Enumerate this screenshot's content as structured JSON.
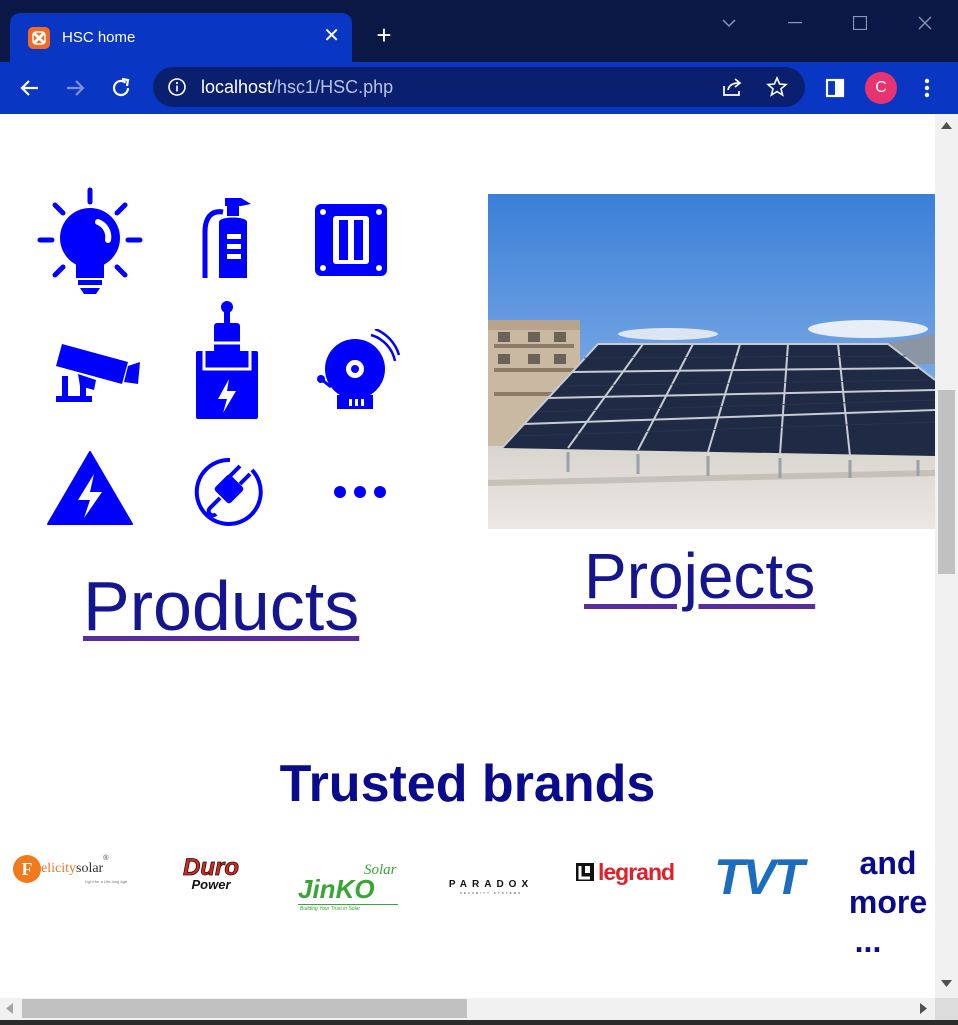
{
  "browser": {
    "tab_title": "HSC home",
    "url_host": "localhost",
    "url_path": "/hsc1/HSC.php",
    "profile_initial": "C",
    "accent_color": "#0a36c4",
    "profile_color": "#e8336e"
  },
  "icons": [
    "lightbulb-icon",
    "fire-extinguisher-icon",
    "wall-switch-icon",
    "cctv-camera-icon",
    "circuit-breaker-icon",
    "alarm-bell-icon",
    "high-voltage-warning-icon",
    "power-plug-icon",
    "more-dots-icon"
  ],
  "main": {
    "products_label": "Products",
    "projects_label": "Projects",
    "brands_title": "Trusted brands",
    "and_more_line1": "and",
    "and_more_line2": "more",
    "and_more_line3": "..."
  },
  "brands": {
    "felicity_a": "F",
    "felicity_b": "elicity",
    "felicity_c": "solar",
    "felicity_reg": "®",
    "felicity_tagline": "Light for a Life-long Age",
    "duro_line1": "Duro",
    "duro_line2": "Power",
    "jinko_solar": "Solar",
    "jinko_name": "JinKO",
    "jinko_tagline": "Building Your Trust in Solar",
    "paradox_name": "PARADOX",
    "paradox_sub": "SECURITY SYSTEMS",
    "legrand_name": "legrand",
    "tvt_name": "TVT"
  }
}
